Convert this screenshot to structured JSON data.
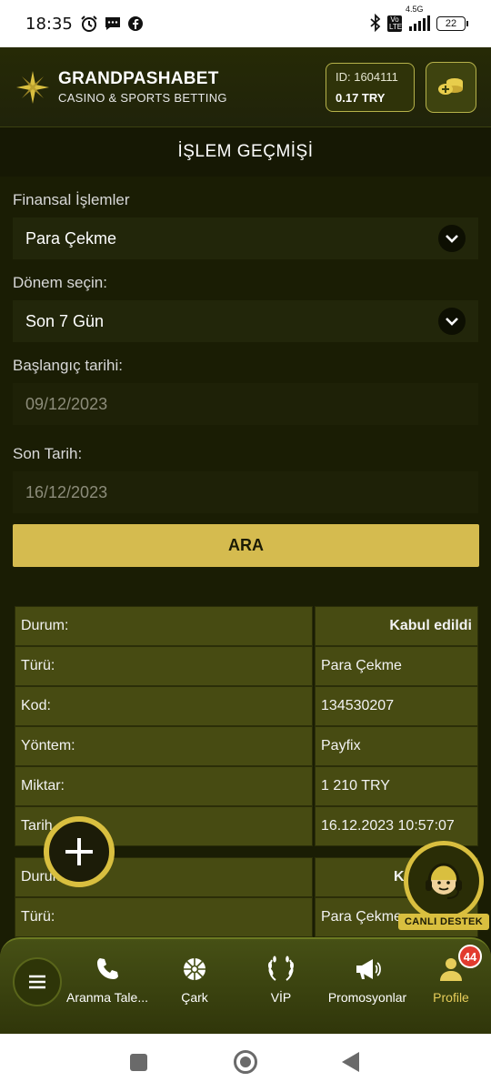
{
  "status_bar": {
    "time": "18:35",
    "network": "4.5G",
    "volte": "Vo LTE",
    "battery": "22"
  },
  "header": {
    "brand_name": "GRANDPASHABET",
    "brand_sub": "CASINO & SPORTS BETTING",
    "account_id": "ID: 1604111",
    "balance": "0.17 TRY",
    "accent_color": "#d5bb4f"
  },
  "page_title": "İŞLEM GEÇMİŞİ",
  "form": {
    "financial_label": "Finansal İşlemler",
    "financial_value": "Para Çekme",
    "period_label": "Dönem seçin:",
    "period_value": "Son 7 Gün",
    "start_label": "Başlangıç tarihi:",
    "start_value": "09/12/2023",
    "end_label": "Son Tarih:",
    "end_value": "16/12/2023",
    "search_button": "ARA"
  },
  "transactions": [
    {
      "rows": [
        {
          "key": "Durum:",
          "value": "Kabul edildi",
          "bold": true
        },
        {
          "key": "Türü:",
          "value": "Para Çekme"
        },
        {
          "key": "Kod:",
          "value": "134530207"
        },
        {
          "key": "Yöntem:",
          "value": "Payfix"
        },
        {
          "key": "Miktar:",
          "value": "1 210 TRY"
        },
        {
          "key": "Tarih",
          "value": "16.12.2023 10:57:07"
        }
      ]
    },
    {
      "rows": [
        {
          "key": "Durum:",
          "value": "Ka",
          "bold": true
        },
        {
          "key": "Türü:",
          "value": "Para Çekme"
        }
      ]
    }
  ],
  "live_support_label": "CANLI DESTEK",
  "bottom_nav": {
    "items": [
      {
        "label": "Aranma Tale...",
        "icon": "phone-icon"
      },
      {
        "label": "Çark",
        "icon": "wheel-icon"
      },
      {
        "label": "VİP",
        "icon": "laurel-icon"
      },
      {
        "label": "Promosyonlar",
        "icon": "megaphone-icon"
      },
      {
        "label": "Profile",
        "icon": "user-icon",
        "badge": "44"
      }
    ]
  }
}
